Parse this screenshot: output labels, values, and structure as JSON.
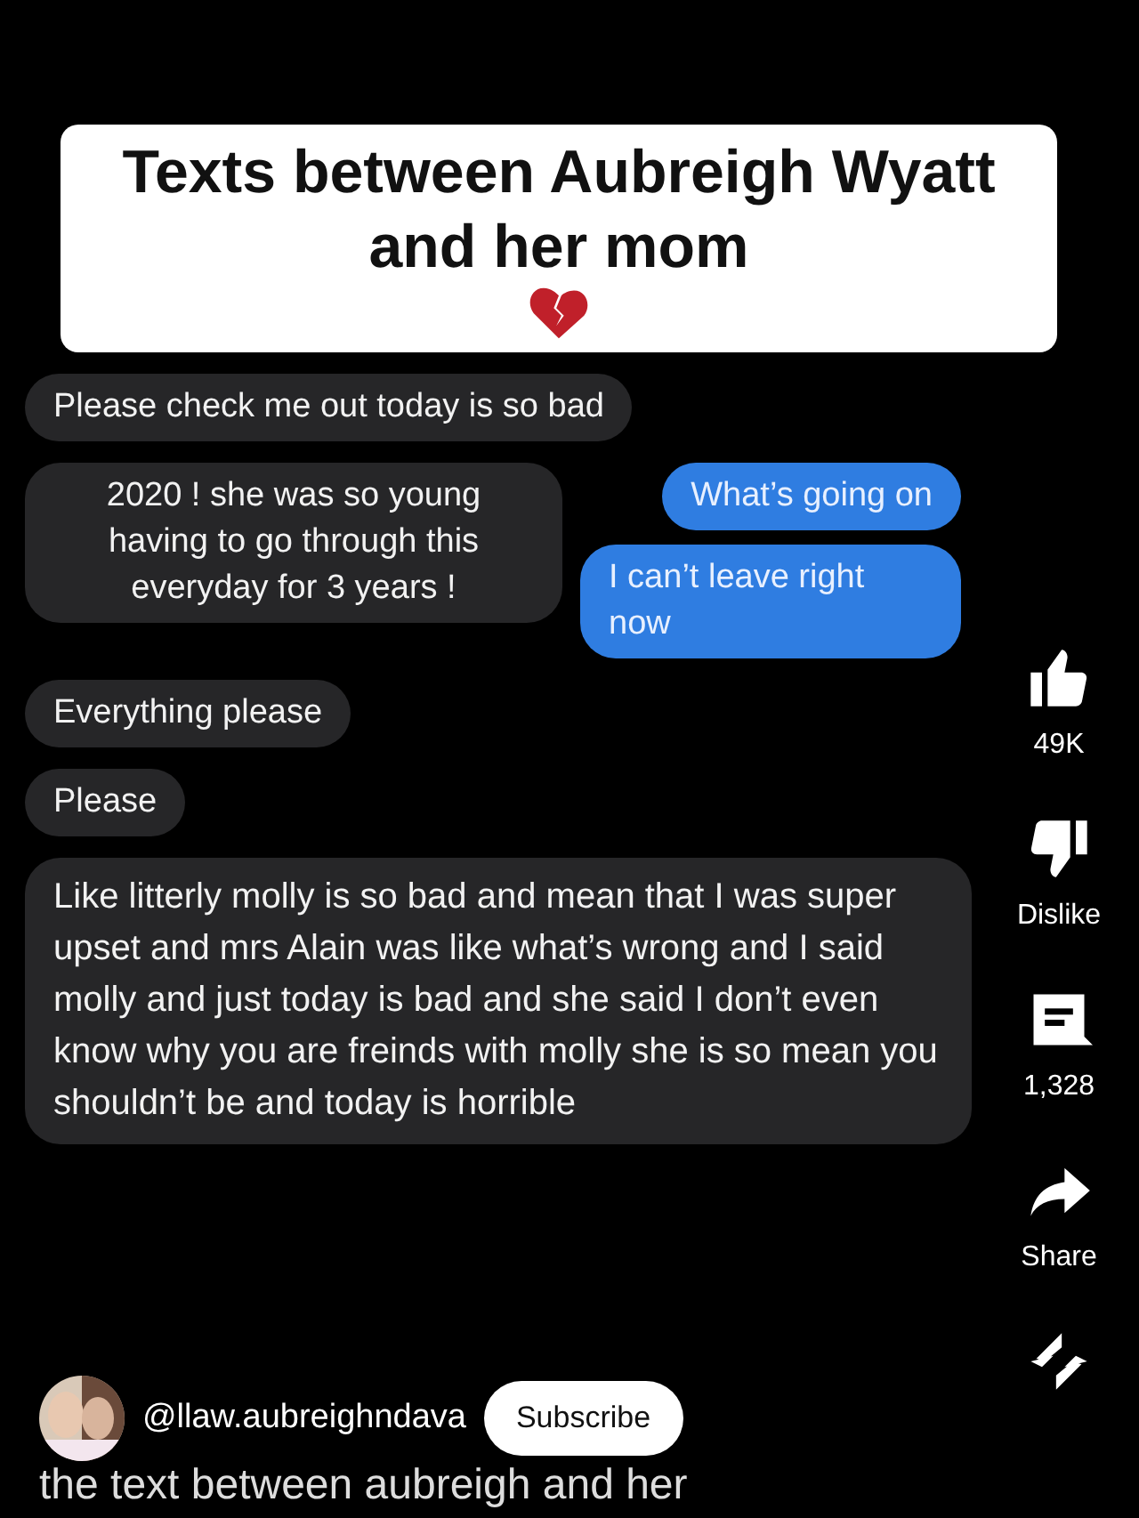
{
  "video": {
    "title_overlay": "Texts between Aubreigh Wyatt and her mom",
    "thread": [
      {
        "kind": "single",
        "sent": false,
        "text": "Please check me out today is so bad"
      },
      {
        "kind": "split",
        "left": "2020 ! she was so young having to go through this everyday for 3 years !",
        "right": [
          "What’s going on",
          "I can’t leave right now"
        ]
      },
      {
        "kind": "single",
        "sent": false,
        "text": "Everything please"
      },
      {
        "kind": "single",
        "sent": false,
        "text": "Please"
      },
      {
        "kind": "single",
        "sent": false,
        "text": "Like litterly molly is so bad and mean that I was super upset and mrs Alain was like what’s wrong and I said molly and just today is bad and she said I don’t even know why you are freinds with molly she is so mean you shouldn’t be and today is horrible"
      }
    ]
  },
  "actions": [
    {
      "kind": "like",
      "label": "49K"
    },
    {
      "kind": "dislike",
      "label": "Dislike"
    },
    {
      "kind": "comment",
      "label": "1,328"
    },
    {
      "kind": "share",
      "label": "Share"
    },
    {
      "kind": "remix"
    }
  ],
  "channel": {
    "handle": "@llaw.aubreighndava",
    "subscribe": "Subscribe"
  },
  "caption": "the text between aubreigh and her"
}
